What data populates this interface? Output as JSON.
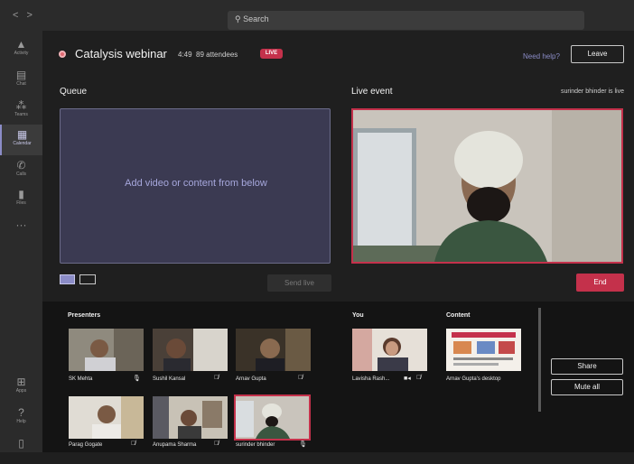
{
  "search": {
    "placeholder": "Search"
  },
  "rail": [
    {
      "label": "Activity",
      "icon": "bell-icon"
    },
    {
      "label": "Chat",
      "icon": "chat-icon"
    },
    {
      "label": "Teams",
      "icon": "teams-icon"
    },
    {
      "label": "Calendar",
      "icon": "calendar-icon"
    },
    {
      "label": "Calls",
      "icon": "phone-icon"
    },
    {
      "label": "Files",
      "icon": "file-icon"
    },
    {
      "label": "Apps",
      "icon": "apps-icon"
    },
    {
      "label": "Help",
      "icon": "help-icon"
    }
  ],
  "header": {
    "title": "Catalysis webinar",
    "time": "4:49",
    "attendees": "89 attendees",
    "live_badge": "LIVE",
    "help": "Need help?",
    "leave": "Leave"
  },
  "queue": {
    "heading": "Queue",
    "placeholder": "Add video or content from below",
    "send": "Send live"
  },
  "live": {
    "heading": "Live event",
    "status": "surinder bhinder is live",
    "end": "End"
  },
  "presenters": {
    "heading": "Presenters",
    "items": [
      {
        "name": "SK Mehta"
      },
      {
        "name": "Sushil Kansal"
      },
      {
        "name": "Arnav Gupta"
      },
      {
        "name": "Parag Gogate"
      },
      {
        "name": "Anupama Sharma"
      },
      {
        "name": "surinder bhinder"
      }
    ]
  },
  "you": {
    "heading": "You",
    "name": "Lavisha Rash..."
  },
  "content": {
    "heading": "Content",
    "name": "Arnav Gupta's desktop"
  },
  "controls": {
    "share": "Share",
    "mute_all": "Mute all"
  },
  "colors": {
    "accent": "#8b8cc7",
    "live_red": "#c4314b",
    "background": "#1f1f1f"
  }
}
